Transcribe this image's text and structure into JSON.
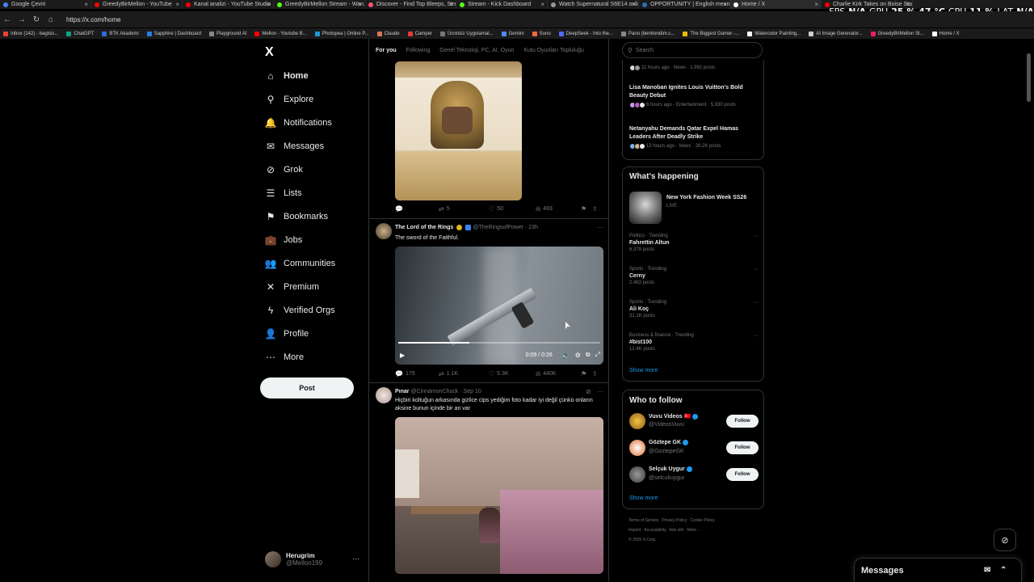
{
  "browser": {
    "tabs": [
      {
        "title": "Google Çeviri",
        "color": "#4285f4"
      },
      {
        "title": "GreedyBirMellon - YouTube",
        "color": "#ff0000"
      },
      {
        "title": "Kanal analizi - YouTube Studio",
        "color": "#ff0000"
      },
      {
        "title": "GreedyBirMellon Stream - Wan...",
        "color": "#53fc18"
      },
      {
        "title": "Discover - Find Top Bleeps, Stre...",
        "color": "#ff4f6d"
      },
      {
        "title": "Stream - Kick Dashboard",
        "color": "#53fc18"
      },
      {
        "title": "Watch Supernatural S6E14 onlin...",
        "color": "#999999"
      },
      {
        "title": "OPPORTUNITY | English meaning...",
        "color": "#2a6ebb"
      },
      {
        "title": "Home / X",
        "color": "#ffffff"
      },
      {
        "title": "Charlie Kirk Takes on Boise Stat...",
        "color": "#ff0000"
      }
    ],
    "url": "https://x.com/home",
    "hud": {
      "fps_label": "FPS",
      "fps_value": "N/A",
      "gpu_label": "GPU",
      "gpu_value": "25 % 47 °C",
      "cpu_label": "CPU",
      "cpu_value": "11 %",
      "lat_label": "LAT",
      "lat_value": "N/A"
    },
    "bookmarks": [
      {
        "label": "Inbox (142) - bagisis...",
        "color": "#ea4335"
      },
      {
        "label": "ChatGPT",
        "color": "#10a37f"
      },
      {
        "label": "BTK Akademi",
        "color": "#2d6cdf"
      },
      {
        "label": "Sapphire | Dashboard",
        "color": "#2a7de1"
      },
      {
        "label": "Playground AI",
        "color": "#888888"
      },
      {
        "label": "Mellon - Youtube B...",
        "color": "#ff0000"
      },
      {
        "label": "Photopea | Online P...",
        "color": "#1b9ad6"
      },
      {
        "label": "Claude",
        "color": "#d97757"
      },
      {
        "label": "Camper",
        "color": "#e53935"
      },
      {
        "label": "Ücretsiz Uygulamal...",
        "color": "#777777"
      },
      {
        "label": "Gemini",
        "color": "#4f8bf5"
      },
      {
        "label": "Suno",
        "color": "#f06b3a"
      },
      {
        "label": "DeepSeek - Into the...",
        "color": "#4d6bfe"
      },
      {
        "label": "Pano (bentrendim.c...",
        "color": "#888888"
      },
      {
        "label": "The Biggest Gamer -...",
        "color": "#f2b705"
      },
      {
        "label": "Watercolor Painting...",
        "color": "#ffffff"
      },
      {
        "label": "AI Image Generator...",
        "color": "#cccccc"
      },
      {
        "label": "GreedyBirMellon St...",
        "color": "#e91e63"
      },
      {
        "label": "Home / X",
        "color": "#ffffff"
      }
    ]
  },
  "sidebar": {
    "logo": "X",
    "items": [
      {
        "label": "Home",
        "icon": "home-icon",
        "glyph": "⌂"
      },
      {
        "label": "Explore",
        "icon": "search-icon",
        "glyph": "⚲"
      },
      {
        "label": "Notifications",
        "icon": "bell-icon",
        "glyph": "🔔"
      },
      {
        "label": "Messages",
        "icon": "envelope-icon",
        "glyph": "✉"
      },
      {
        "label": "Grok",
        "icon": "grok-icon",
        "glyph": "⊘"
      },
      {
        "label": "Lists",
        "icon": "list-icon",
        "glyph": "☰"
      },
      {
        "label": "Bookmarks",
        "icon": "bookmark-icon",
        "glyph": "⚑"
      },
      {
        "label": "Jobs",
        "icon": "briefcase-icon",
        "glyph": "💼"
      },
      {
        "label": "Communities",
        "icon": "people-icon",
        "glyph": "👥"
      },
      {
        "label": "Premium",
        "icon": "x-logo-icon",
        "glyph": "✕"
      },
      {
        "label": "Verified Orgs",
        "icon": "lightning-icon",
        "glyph": "ϟ"
      },
      {
        "label": "Profile",
        "icon": "person-icon",
        "glyph": "👤"
      },
      {
        "label": "More",
        "icon": "more-circle-icon",
        "glyph": "⋯"
      }
    ],
    "post_label": "Post",
    "account": {
      "name": "Herugrim",
      "handle": "@Mellon199",
      "more": "···"
    }
  },
  "timeline": {
    "tabs": [
      "For you",
      "Following",
      "Genel Teknoloji, PC, AI, Oyun",
      "Kutu Oyunları Topluluğu"
    ],
    "tweet1": {
      "reply": "",
      "retweet": "5",
      "like": "50",
      "views": "493"
    },
    "tweet2": {
      "name": "The Lord of the Rings",
      "handle": "@TheRingsofPower · 23h",
      "text": "The sword of the Faithful.",
      "video_time": "0:09 / 0:26",
      "progress": 0.35,
      "reply": "179",
      "retweet": "1.1K",
      "like": "5.3K",
      "views": "440K"
    },
    "tweet3": {
      "name": "Pınar",
      "handle": "@CinnamonChuck · Sep 10",
      "text": "Hiçbiri koltuğun arkasında gizlice cips yediğim foto kadar iyi değil çünkü onların aksine bunun içinde bir an var"
    }
  },
  "right": {
    "search_placeholder": "Search",
    "news": [
      {
        "title": "",
        "meta": "11 hours ago · News · 1,992 posts"
      },
      {
        "title": "Lisa Manoban Ignites Louis Vuitton's Bold Beauty Debut",
        "meta": "6 hours ago · Entertainment · 5,930 posts"
      },
      {
        "title": "Netanyahu Demands Qatar Expel Hamas Leaders After Deadly Strike",
        "meta": "13 hours ago · News · 26.2K posts"
      }
    ],
    "whats_happening": "What's happening",
    "nyfw": {
      "title": "New York Fashion Week SS26",
      "live": "LIVE"
    },
    "trends": [
      {
        "category": "Politics · Trending",
        "title": "Fahrettin Altun",
        "posts": "6,378 posts"
      },
      {
        "category": "Sports · Trending",
        "title": "Cerny",
        "posts": "2,463 posts"
      },
      {
        "category": "Sports · Trending",
        "title": "Ali Koç",
        "posts": "31.1K posts"
      },
      {
        "category": "Business & finance · Trending",
        "title": "#bist100",
        "posts": "12.4K posts"
      }
    ],
    "show_more": "Show more",
    "who_to_follow": "Who to follow",
    "follow_suggestions": [
      {
        "name": "Vuvu Videos 🇹🇷",
        "handle": "@VideosVuvu",
        "button": "Follow"
      },
      {
        "name": "Göztepe GK",
        "handle": "@GoztepeGK",
        "button": "Follow"
      },
      {
        "name": "Selçuk Uygur",
        "handle": "@selcukuygur",
        "button": "Follow"
      }
    ],
    "footer": [
      "Terms of Service",
      "Privacy Policy",
      "Cookie Policy",
      "Imprint",
      "Accessibility",
      "Ads info",
      "More ···",
      "© 2025 X Corp."
    ]
  },
  "messages_drawer": {
    "title": "Messages"
  },
  "accent": "#1d9bf0"
}
